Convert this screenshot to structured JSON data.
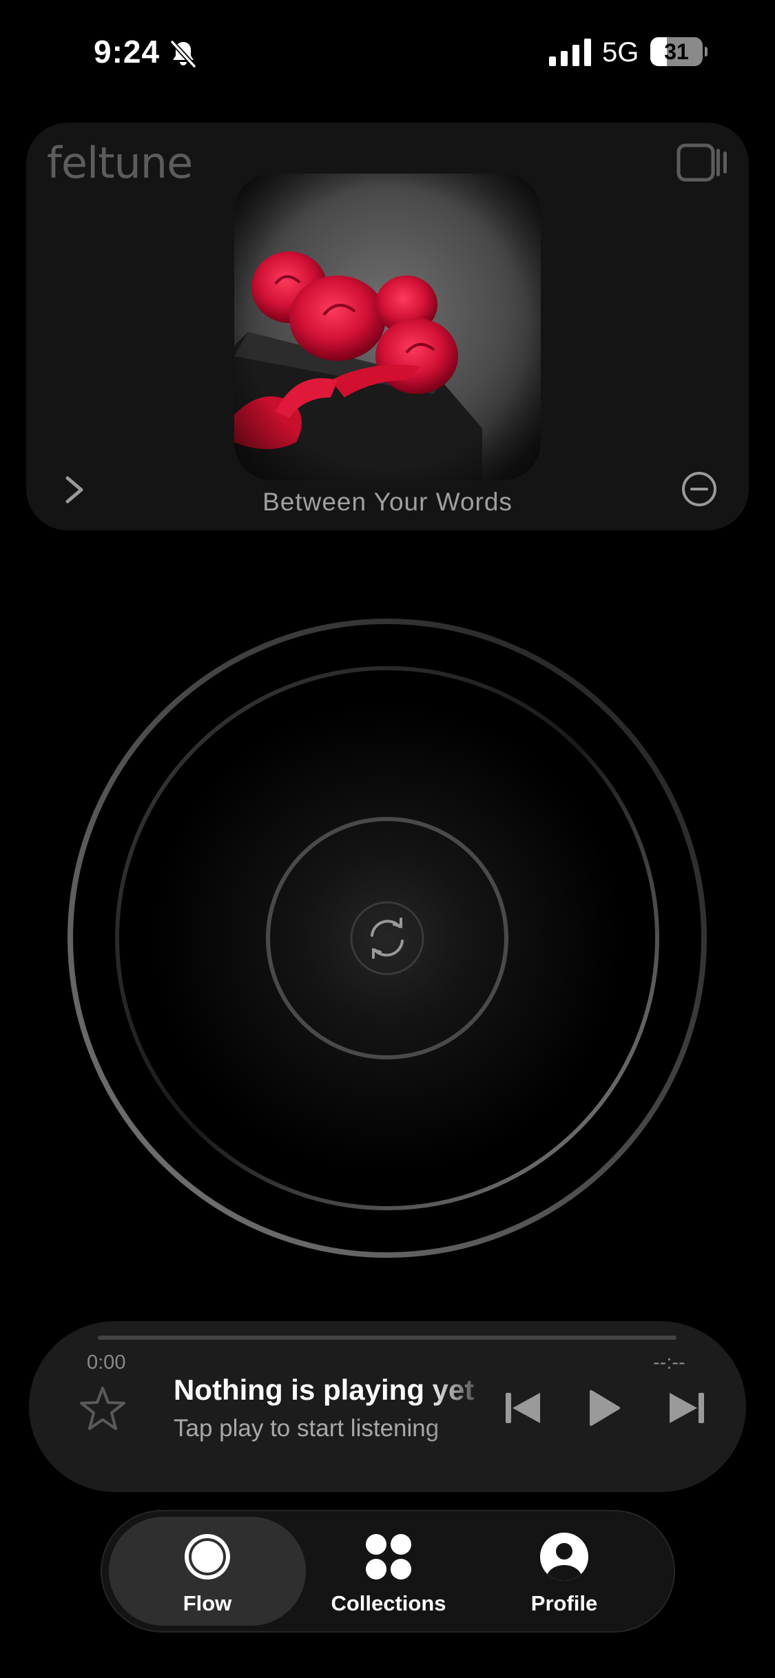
{
  "status_bar": {
    "time": "9:24",
    "network": "5G",
    "battery_level": "31",
    "battery_fraction": 0.31
  },
  "now_card": {
    "brand": "feltune",
    "track_title": "Between Your Words"
  },
  "player": {
    "elapsed": "0:00",
    "remaining": "--:--",
    "progress_fraction": 0,
    "title": "Nothing is playing yet",
    "subtitle": "Tap play to start listening"
  },
  "tabs": [
    {
      "label": "Flow",
      "icon": "circle-icon",
      "active": true
    },
    {
      "label": "Collections",
      "icon": "grid-dots-icon",
      "active": false
    },
    {
      "label": "Profile",
      "icon": "person-icon",
      "active": false
    }
  ],
  "colors": {
    "background": "#000000",
    "card": "#141414",
    "player": "#1c1c1c",
    "active_tab": "#2f2f2f",
    "muted_text": "#a0a0a0"
  }
}
